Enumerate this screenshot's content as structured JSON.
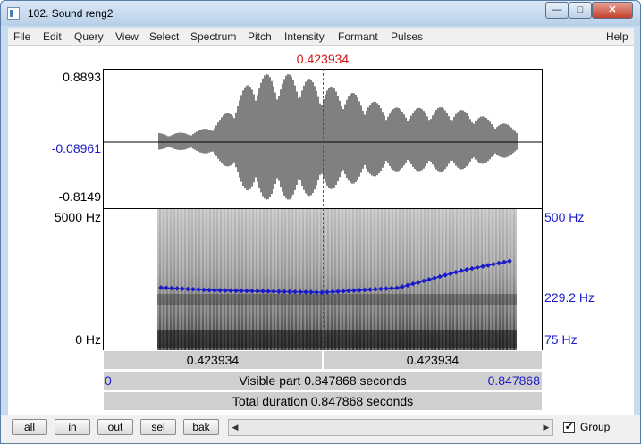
{
  "window": {
    "title": "102. Sound reng2",
    "minimize_glyph": "—",
    "maximize_glyph": "□",
    "close_glyph": "✕"
  },
  "menu": {
    "items": [
      "File",
      "Edit",
      "Query",
      "View",
      "Select",
      "Spectrum",
      "Pitch",
      "Intensity",
      "Formant",
      "Pulses"
    ],
    "help": "Help"
  },
  "cursor": {
    "time_label": "0.423934",
    "cursor_fraction": 0.5
  },
  "waveform": {
    "max_label": "0.8893",
    "mid_label": "-0.08961",
    "min_label": "-0.8149"
  },
  "spectrogram": {
    "top_label": "5000 Hz",
    "bottom_label": "0 Hz",
    "pitch_top_label": "500 Hz",
    "pitch_mid_label": "229.2 Hz",
    "pitch_bottom_label": "75 Hz"
  },
  "bars": {
    "left_segment": "0.423934",
    "right_segment": "0.423934",
    "visible_start": "0",
    "visible_text": "Visible part 0.847868 seconds",
    "visible_end": "0.847868",
    "total_text": "Total duration 0.847868 seconds"
  },
  "toolbar": {
    "all": "all",
    "in": "in",
    "out": "out",
    "sel": "sel",
    "bak": "bak",
    "group_label": "Group",
    "group_checked": "✔"
  },
  "colors": {
    "accent_red": "#d41616",
    "pitch_blue": "#1a1acb"
  }
}
